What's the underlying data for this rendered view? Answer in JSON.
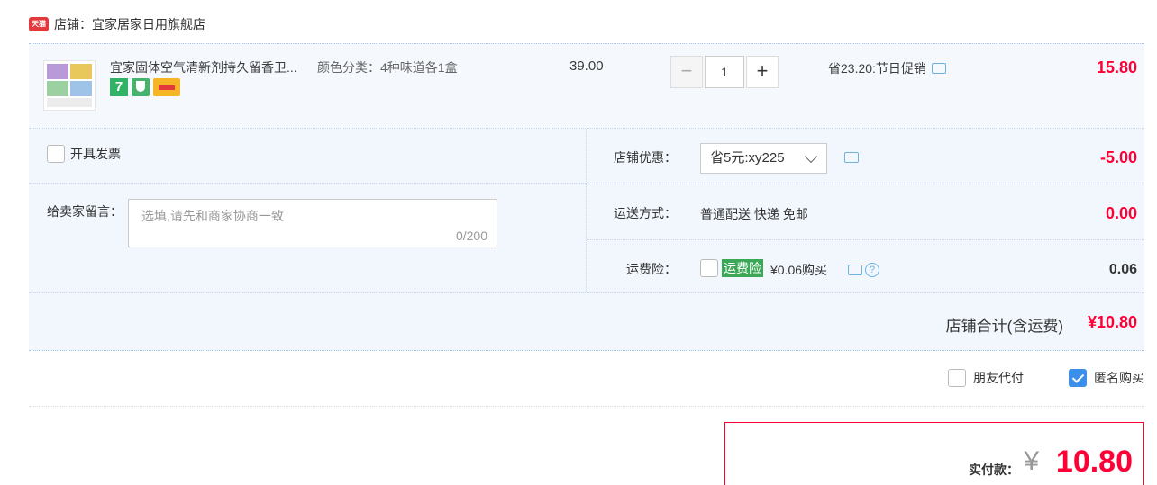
{
  "shop": {
    "logo_text": "天猫",
    "label": "店铺：宜家居家日用旗舰店"
  },
  "item": {
    "title": "宜家固体空气清新剂持久留香卫...",
    "sku": "颜色分类：4种味道各1盒",
    "badges": [
      "seven-day-return-icon",
      "guarantee-icon",
      "credit-card-icon"
    ],
    "unit_price": "39.00",
    "quantity": "1",
    "qty_minus": "−",
    "qty_plus": "+",
    "discount": "省23.20:节日促销",
    "subtotal": "15.80"
  },
  "invoice": {
    "label": "开具发票",
    "checked": false
  },
  "memo": {
    "label": "给卖家留言：",
    "placeholder": "选填,请先和商家协商一致",
    "counter": "0/200"
  },
  "store_coupon": {
    "label": "店铺优惠：",
    "selected": "省5元:xy225",
    "value": "-5.00"
  },
  "shipping": {
    "label": "运送方式：",
    "method": "普通配送 快递 免邮",
    "value": "0.00"
  },
  "insurance": {
    "label": "运费险：",
    "tag": "运费险",
    "text": "¥0.06购买",
    "value": "0.06",
    "checked": false
  },
  "store_total": {
    "label": "店铺合计(含运费)",
    "value": "¥10.80"
  },
  "options": {
    "friend_pay": {
      "label": "朋友代付",
      "checked": false
    },
    "anonymous": {
      "label": "匿名购买",
      "checked": true
    }
  },
  "payment": {
    "label": "实付款：",
    "currency": "¥",
    "amount": "10.80"
  },
  "colors": {
    "accent_red": "#ff0036",
    "panel_bg": "#f2f7fd",
    "insurance_green": "#3aa856",
    "checkbox_blue": "#3c8ee8"
  }
}
